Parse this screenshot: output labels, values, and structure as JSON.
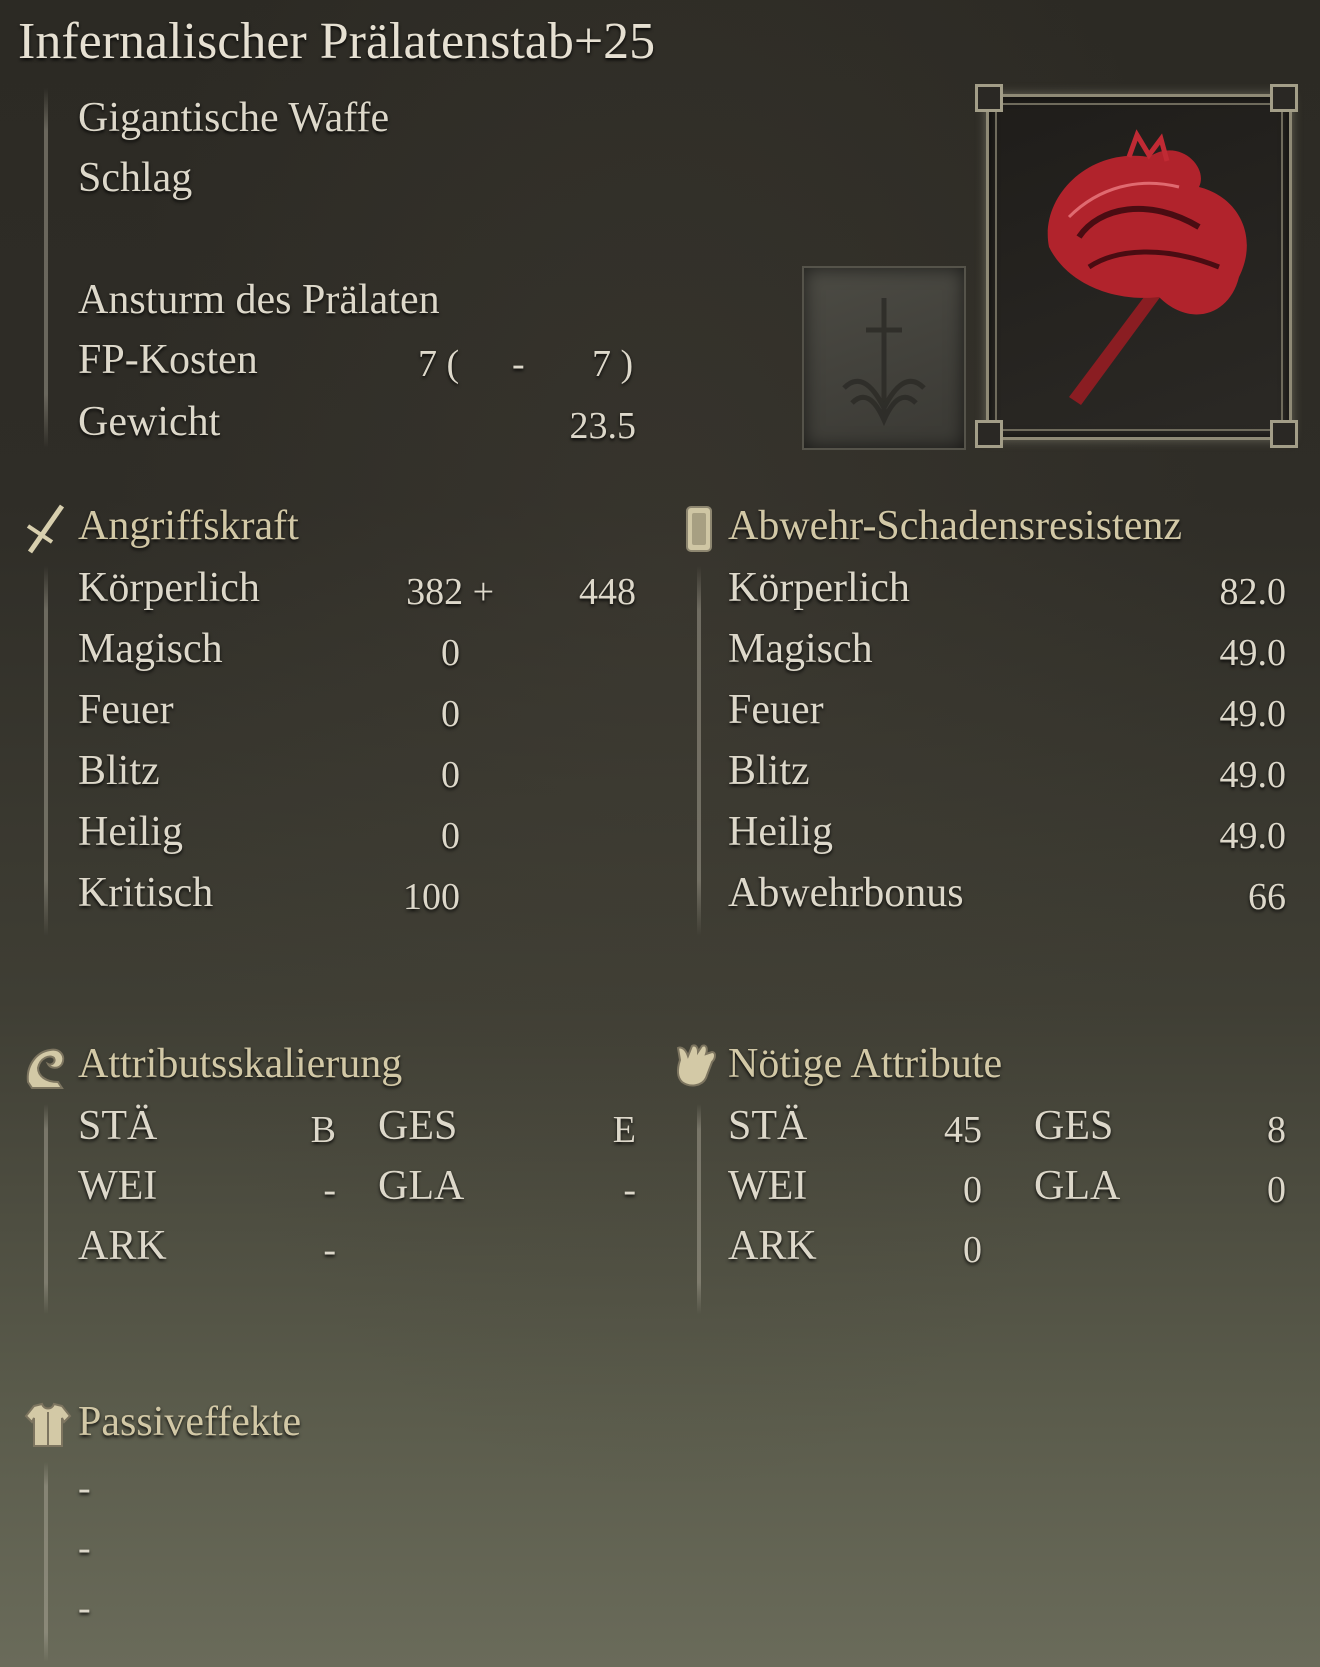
{
  "weapon": {
    "name": "Infernalischer Prälatenstab+25",
    "type": "Gigantische Waffe",
    "damage_type": "Schlag",
    "skill": "Ansturm des Prälaten",
    "fp_label": "FP-Kosten",
    "fp_value_a": "7 (",
    "fp_dash": "-",
    "fp_value_b": "7 )",
    "weight_label": "Gewicht",
    "weight_value": "23.5",
    "image_icon": "red-great-hammer-icon",
    "skill_icon": "sword-ash-of-war-icon"
  },
  "attack": {
    "header": "Angriffskraft",
    "icon": "sword-icon",
    "rows": [
      {
        "label": "Körperlich",
        "value": "382 +",
        "bonus": "448"
      },
      {
        "label": "Magisch",
        "value": "0",
        "bonus": ""
      },
      {
        "label": "Feuer",
        "value": "0",
        "bonus": ""
      },
      {
        "label": "Blitz",
        "value": "0",
        "bonus": ""
      },
      {
        "label": "Heilig",
        "value": "0",
        "bonus": ""
      },
      {
        "label": "Kritisch",
        "value": "100",
        "bonus": ""
      }
    ]
  },
  "guard": {
    "header": "Abwehr-Schadensresistenz",
    "icon": "shield-icon",
    "rows": [
      {
        "label": "Körperlich",
        "value": "82.0"
      },
      {
        "label": "Magisch",
        "value": "49.0"
      },
      {
        "label": "Feuer",
        "value": "49.0"
      },
      {
        "label": "Blitz",
        "value": "49.0"
      },
      {
        "label": "Heilig",
        "value": "49.0"
      },
      {
        "label": "Abwehrbonus",
        "value": "66"
      }
    ]
  },
  "scaling": {
    "header": "Attributsskalierung",
    "icon": "flexed-arm-icon",
    "rows": [
      {
        "a_label": "STÄ",
        "a_value": "B",
        "b_label": "GES",
        "b_value": "E"
      },
      {
        "a_label": "WEI",
        "a_value": "-",
        "b_label": "GLA",
        "b_value": "-"
      },
      {
        "a_label": "ARK",
        "a_value": "-",
        "b_label": "",
        "b_value": ""
      }
    ]
  },
  "requirements": {
    "header": "Nötige Attribute",
    "icon": "hand-icon",
    "rows": [
      {
        "a_label": "STÄ",
        "a_value": "45",
        "b_label": "GES",
        "b_value": "8"
      },
      {
        "a_label": "WEI",
        "a_value": "0",
        "b_label": "GLA",
        "b_value": "0"
      },
      {
        "a_label": "ARK",
        "a_value": "0",
        "b_label": "",
        "b_value": ""
      }
    ]
  },
  "passive": {
    "header": "Passiveffekte",
    "icon": "armor-icon",
    "items": [
      "-",
      "-",
      "-"
    ]
  }
}
